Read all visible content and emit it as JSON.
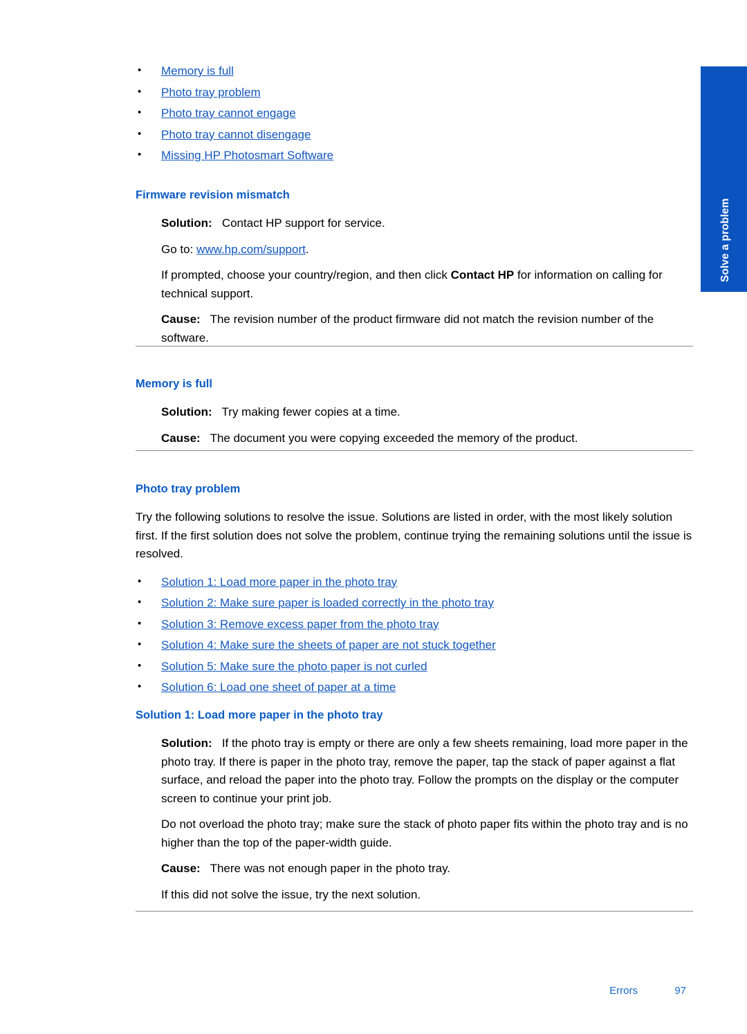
{
  "side_tab": {
    "label": "Solve a problem",
    "background_color": "#0b54bf",
    "text_color": "#ffffff"
  },
  "colors": {
    "link": "#1257bd",
    "heading": "#0b5cc4",
    "footer": "#1768c9",
    "rule": "#8a8a8a",
    "body": "#000000"
  },
  "top_link_list": [
    {
      "label": "Memory is full"
    },
    {
      "label": "Photo tray problem"
    },
    {
      "label": "Photo tray cannot engage"
    },
    {
      "label": "Photo tray cannot disengage"
    },
    {
      "label": "Missing HP Photosmart Software"
    }
  ],
  "sections": {
    "firmware": {
      "heading": "Firmware revision mismatch",
      "solution_label": "Solution:",
      "solution_text": "Contact HP support for service.",
      "goto_prefix": "Go to:",
      "goto_link": "www.hp.com/support",
      "goto_suffix": ".",
      "prompt_before": "If prompted, choose your country/region, and then click ",
      "prompt_bold": "Contact HP",
      "prompt_after": " for information on calling for technical support.",
      "cause_label": "Cause:",
      "cause_text": "The revision number of the product firmware did not match the revision number of the software."
    },
    "memory_full": {
      "heading": "Memory is full",
      "solution_label": "Solution:",
      "solution_text": "Try making fewer copies at a time.",
      "cause_label": "Cause:",
      "cause_text": "The document you were copying exceeded the memory of the product."
    },
    "photo_tray_problem": {
      "heading": "Photo tray problem",
      "intro": "Try the following solutions to resolve the issue. Solutions are listed in order, with the most likely solution first. If the first solution does not solve the problem, continue trying the remaining solutions until the issue is resolved.",
      "solution_links": [
        {
          "label": "Solution 1: Load more paper in the photo tray"
        },
        {
          "label": "Solution 2: Make sure paper is loaded correctly in the photo tray"
        },
        {
          "label": "Solution 3: Remove excess paper from the photo tray"
        },
        {
          "label": "Solution 4: Make sure the sheets of paper are not stuck together"
        },
        {
          "label": "Solution 5: Make sure the photo paper is not curled"
        },
        {
          "label": "Solution 6: Load one sheet of paper at a time"
        }
      ]
    },
    "solution_1": {
      "heading": "Solution 1: Load more paper in the photo tray",
      "solution_label": "Solution:",
      "solution_text": "If the photo tray is empty or there are only a few sheets remaining, load more paper in the photo tray. If there is paper in the photo tray, remove the paper, tap the stack of paper against a flat surface, and reload the paper into the photo tray. Follow the prompts on the display or the computer screen to continue your print job.",
      "note_text": "Do not overload the photo tray; make sure the stack of photo paper fits within the photo tray and is no higher than the top of the paper-width guide.",
      "cause_label": "Cause:",
      "cause_text": "There was not enough paper in the photo tray.",
      "next_text": "If this did not solve the issue, try the next solution."
    }
  },
  "footer": {
    "chapter": "Errors",
    "page_number": "97"
  }
}
